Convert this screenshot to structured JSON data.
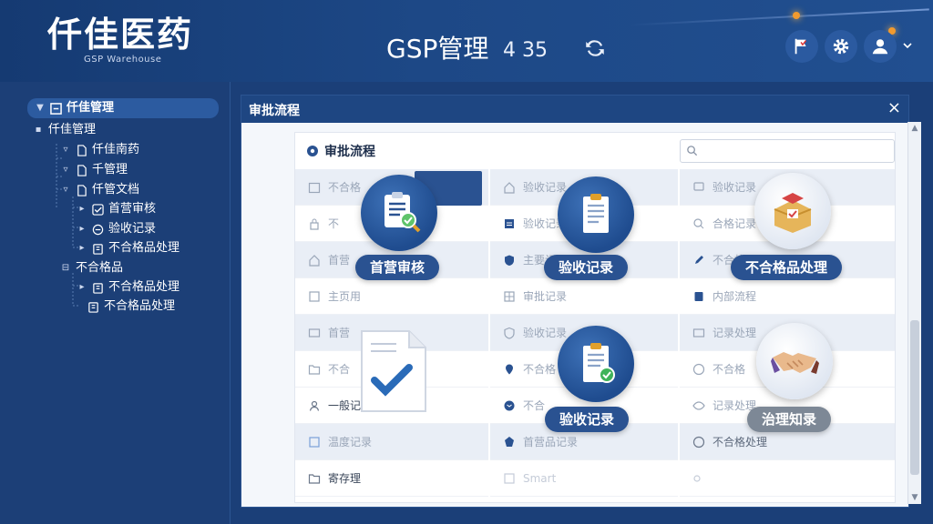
{
  "header": {
    "brand_title": "仟佳医药",
    "brand_subtitle": "GSP Warehouse",
    "module_title": "GSP管理",
    "clock": "4 35"
  },
  "sidebar": {
    "items": [
      {
        "label": "仟佳管理"
      },
      {
        "label": "仟佳管理"
      },
      {
        "label": "仟佳南药"
      },
      {
        "label": "千管理"
      },
      {
        "label": "仟管文档"
      },
      {
        "label": "首营审核"
      },
      {
        "label": "验收记录"
      },
      {
        "label": "不合格品处理"
      },
      {
        "label": "不合格品"
      },
      {
        "label": "不合格品处理"
      },
      {
        "label": "不合格品处理"
      }
    ]
  },
  "panel": {
    "bar_title": "审批流程",
    "close": "×",
    "inner_title": "审批流程",
    "search_placeholder": ""
  },
  "grid": {
    "col1": [
      "不合格",
      "不",
      "首营",
      "主页用",
      "首营",
      "不合",
      "一般记录",
      "温度记录",
      "寄存理"
    ],
    "col2": [
      "验收记录",
      "验收记录",
      "主要记录",
      "审批记录",
      "验收记录",
      "不合格",
      "不合",
      "首营品记录",
      "Smart"
    ],
    "col3": [
      "验收记录",
      "合格记录",
      "不合格记录",
      "内部流程",
      "记录处理",
      "不合格",
      "记录处理",
      "不合格处理",
      ""
    ]
  },
  "tiles": [
    {
      "label": "首营审核"
    },
    {
      "label": "验收记录"
    },
    {
      "label": "不合格品处理"
    },
    {
      "label": "验收记录"
    },
    {
      "label": "治理知录"
    }
  ],
  "colors": {
    "header_bg": "#1d4886",
    "panel_bar": "#1e4682",
    "accent": "#f29a2e",
    "tile_label": "#2a5291"
  }
}
